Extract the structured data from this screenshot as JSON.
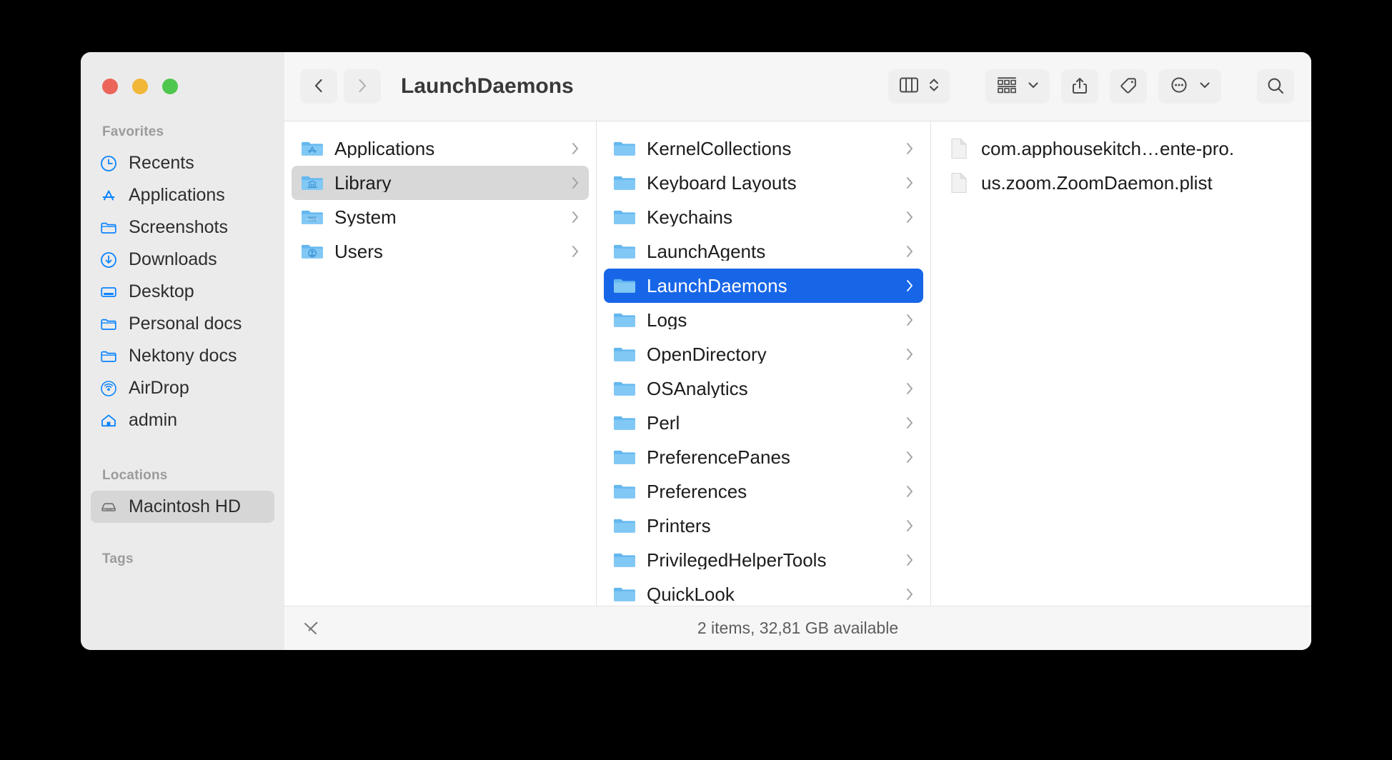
{
  "window": {
    "title": "LaunchDaemons",
    "traffic_lights": [
      {
        "name": "close-button",
        "color": "#eb655a"
      },
      {
        "name": "minimize-button",
        "color": "#f0b738"
      },
      {
        "name": "zoom-button",
        "color": "#4fc74f"
      }
    ]
  },
  "toolbar": {
    "back_icon": "chevron-left-icon",
    "forward_icon": "chevron-right-icon",
    "view_mode_icon": "column-view-icon",
    "view_mode_stepper_icon": "up-down-chevron-icon",
    "group_icon": "group-by-icon",
    "group_chevron_icon": "chevron-down-icon",
    "share_icon": "share-icon",
    "tag_icon": "tag-icon",
    "more_icon": "ellipsis-circle-icon",
    "more_chevron_icon": "chevron-down-icon",
    "search_icon": "search-icon"
  },
  "sidebar": {
    "sections": [
      {
        "name": "Favorites",
        "items": [
          {
            "label": "Recents",
            "icon": "clock-icon",
            "selected": false
          },
          {
            "label": "Applications",
            "icon": "app-store-icon",
            "selected": false
          },
          {
            "label": "Screenshots",
            "icon": "folder-icon",
            "selected": false
          },
          {
            "label": "Downloads",
            "icon": "download-icon",
            "selected": false
          },
          {
            "label": "Desktop",
            "icon": "desktop-icon",
            "selected": false
          },
          {
            "label": "Personal docs",
            "icon": "folder-icon",
            "selected": false
          },
          {
            "label": "Nektony docs",
            "icon": "folder-icon",
            "selected": false
          },
          {
            "label": "AirDrop",
            "icon": "airdrop-icon",
            "selected": false
          },
          {
            "label": "admin",
            "icon": "home-icon",
            "selected": false
          }
        ]
      },
      {
        "name": "Locations",
        "items": [
          {
            "label": "Macintosh HD",
            "icon": "hard-drive-icon",
            "selected": true
          }
        ]
      },
      {
        "name": "Tags",
        "items": []
      }
    ]
  },
  "columns": [
    {
      "name": "column-root",
      "items": [
        {
          "label": "Applications",
          "icon": "folder-applications-icon",
          "state": "none",
          "chevron": true
        },
        {
          "label": "Library",
          "icon": "folder-library-icon",
          "state": "highlighted",
          "chevron": true
        },
        {
          "label": "System",
          "icon": "folder-system-icon",
          "state": "none",
          "chevron": true
        },
        {
          "label": "Users",
          "icon": "folder-users-icon",
          "state": "none",
          "chevron": true
        }
      ]
    },
    {
      "name": "column-library",
      "items": [
        {
          "label": "KernelCollections",
          "icon": "folder-icon",
          "state": "none",
          "chevron": true
        },
        {
          "label": "Keyboard Layouts",
          "icon": "folder-icon",
          "state": "none",
          "chevron": true
        },
        {
          "label": "Keychains",
          "icon": "folder-icon",
          "state": "none",
          "chevron": true
        },
        {
          "label": "LaunchAgents",
          "icon": "folder-icon",
          "state": "none",
          "chevron": true
        },
        {
          "label": "LaunchDaemons",
          "icon": "folder-icon",
          "state": "selected",
          "chevron": true
        },
        {
          "label": "Logs",
          "icon": "folder-icon",
          "state": "none",
          "chevron": true
        },
        {
          "label": "OpenDirectory",
          "icon": "folder-icon",
          "state": "none",
          "chevron": true
        },
        {
          "label": "OSAnalytics",
          "icon": "folder-icon",
          "state": "none",
          "chevron": true
        },
        {
          "label": "Perl",
          "icon": "folder-icon",
          "state": "none",
          "chevron": true
        },
        {
          "label": "PreferencePanes",
          "icon": "folder-icon",
          "state": "none",
          "chevron": true
        },
        {
          "label": "Preferences",
          "icon": "folder-icon",
          "state": "none",
          "chevron": true
        },
        {
          "label": "Printers",
          "icon": "folder-icon",
          "state": "none",
          "chevron": true
        },
        {
          "label": "PrivilegedHelperTools",
          "icon": "folder-icon",
          "state": "none",
          "chevron": true
        },
        {
          "label": "QuickLook",
          "icon": "folder-icon",
          "state": "none",
          "chevron": true
        }
      ]
    },
    {
      "name": "column-launchdaemons",
      "items": [
        {
          "label": "com.apphousekitch…ente-pro.",
          "icon": "document-icon",
          "state": "none",
          "chevron": false
        },
        {
          "label": "us.zoom.ZoomDaemon.plist",
          "icon": "document-icon",
          "state": "none",
          "chevron": false
        }
      ]
    }
  ],
  "statusbar": {
    "path_icon": "path-pen-icon",
    "text": "2 items, 32,81 GB available"
  },
  "colors": {
    "selection_blue": "#1866e8",
    "sidebar_bg": "#ecebeb",
    "accent_icon_blue": "#0a84ff",
    "folder_blue": "#6fc0f2"
  }
}
